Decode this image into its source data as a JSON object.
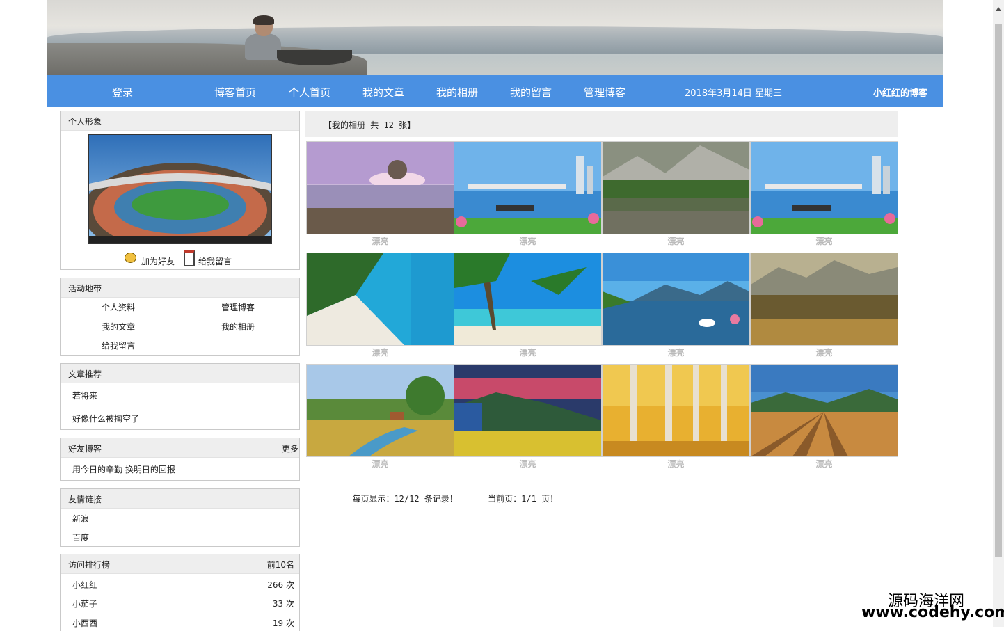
{
  "nav": {
    "login": "登录",
    "blog_home": "博客首页",
    "personal_home": "个人首页",
    "my_articles": "我的文章",
    "my_album": "我的相册",
    "my_messages": "我的留言",
    "manage_blog": "管理博客",
    "date": "2018年3月14日 星期三",
    "blog_owner": "小红红的博客"
  },
  "profile": {
    "title": "个人形象",
    "add_friend": "加为好友",
    "leave_message": "给我留言"
  },
  "activity": {
    "title": "活动地带",
    "items": [
      "个人资料",
      "管理博客",
      "我的文章",
      "我的相册",
      "给我留言"
    ]
  },
  "recommend": {
    "title": "文章推荐",
    "items": [
      "若将来",
      "好像什么被掏空了"
    ]
  },
  "friends": {
    "title": "好友博客",
    "more": "更多",
    "items": [
      "用今日的辛勤 换明日的回报"
    ]
  },
  "links": {
    "title": "友情链接",
    "items": [
      "新浪",
      "百度"
    ]
  },
  "ranking": {
    "title": "访问排行榜",
    "top": "前10名",
    "rows": [
      {
        "name": "小红红",
        "count": "266 次"
      },
      {
        "name": "小茄子",
        "count": "33 次"
      },
      {
        "name": "小西西",
        "count": "19 次"
      }
    ]
  },
  "album": {
    "header": "【我的相册 共 12 张】",
    "captions": [
      "漂亮",
      "漂亮",
      "漂亮",
      "漂亮",
      "漂亮",
      "漂亮",
      "漂亮",
      "漂亮",
      "漂亮",
      "漂亮",
      "漂亮",
      "漂亮"
    ]
  },
  "pager": {
    "per_page": "每页显示：12/12 条记录！",
    "current": "当前页：1/1 页！"
  },
  "watermark": {
    "line1": "源码海洋网",
    "line2": "www.codehy.com"
  }
}
